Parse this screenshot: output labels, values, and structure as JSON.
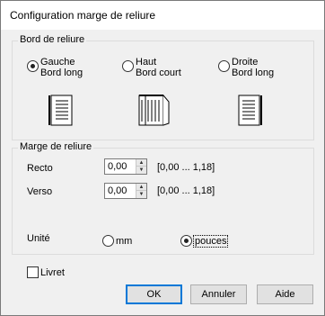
{
  "window": {
    "title": "Configuration marge de reliure"
  },
  "binding_edge": {
    "legend": "Bord de reliure",
    "options": [
      {
        "line1": "Gauche",
        "line2": "Bord long",
        "checked": true,
        "icon": "left-bound-booklet-icon"
      },
      {
        "line1": "Haut",
        "line2": "Bord court",
        "checked": false,
        "icon": "top-bound-booklet-icon"
      },
      {
        "line1": "Droite",
        "line2": "Bord long",
        "checked": false,
        "icon": "right-bound-booklet-icon"
      }
    ]
  },
  "binding_margin": {
    "legend": "Marge de reliure",
    "recto": {
      "label": "Recto",
      "value": "0,00",
      "range": "[0,00 ... 1,18]"
    },
    "verso": {
      "label": "Verso",
      "value": "0,00",
      "range": "[0,00 ... 1,18]"
    },
    "unit": {
      "label": "Unité",
      "options": [
        {
          "label": "mm",
          "checked": false
        },
        {
          "label": "pouces",
          "checked": true
        }
      ]
    }
  },
  "booklet": {
    "label": "Livret",
    "checked": false
  },
  "buttons": {
    "ok": "OK",
    "cancel": "Annuler",
    "help": "Aide"
  }
}
